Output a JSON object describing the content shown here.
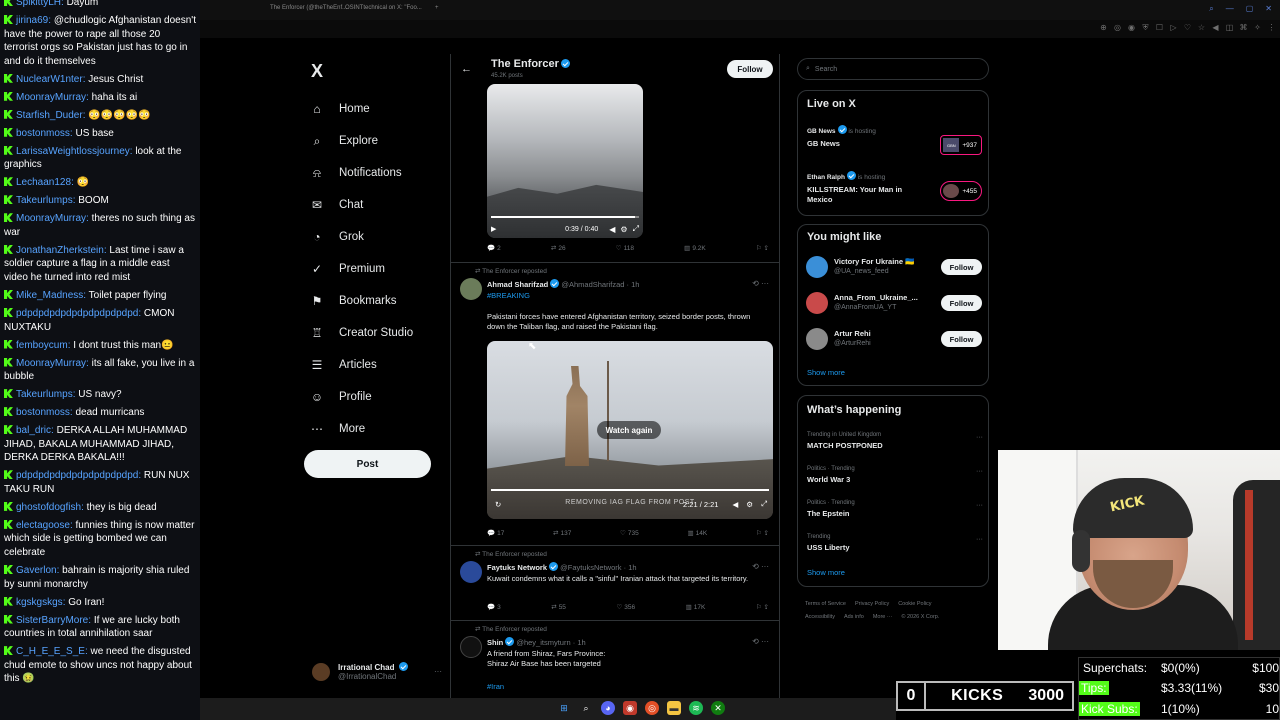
{
  "chat": {
    "messages": [
      {
        "user": "SpikittyLH",
        "text": "Dayum"
      },
      {
        "user": "jirina69",
        "text": "@chudlogic Afghanistan doesn't have the power to rape all those 20 terrorist orgs so Pakistan just has to go in and do it themselves"
      },
      {
        "user": "NuclearW1nter",
        "text": "Jesus Christ"
      },
      {
        "user": "MoonrayMurray",
        "text": "haha its ai"
      },
      {
        "user": "Starfish_Duder",
        "text": "😳😳😳😳😳"
      },
      {
        "user": "bostonmoss",
        "text": "US base"
      },
      {
        "user": "LarissaWeightlossjourney",
        "text": "look at the graphics"
      },
      {
        "user": "Lechaan128",
        "text": "😳"
      },
      {
        "user": "Takeurlumps",
        "text": "BOOM"
      },
      {
        "user": "MoonrayMurray",
        "text": "theres no such thing as war"
      },
      {
        "user": "JonathanZherkstein",
        "text": "Last time i saw a soldier capture a flag in a middle east video he turned into red mist"
      },
      {
        "user": "Mike_Madness",
        "text": "Toilet paper flying"
      },
      {
        "user": "pdpdpdpdpdpdpdpdpdpdpd",
        "text": "CMON NUXTAKU"
      },
      {
        "user": "femboycum",
        "text": "I dont trust this man😐"
      },
      {
        "user": "MoonrayMurray",
        "text": "its all fake, you live in a bubble"
      },
      {
        "user": "Takeurlumps",
        "text": "US navy?"
      },
      {
        "user": "bostonmoss",
        "text": "dead murricans"
      },
      {
        "user": "bal_dric",
        "text": "DERKA ALLAH MUHAMMAD JIHAD, BAKALA MUHAMMAD JIHAD, DERKA DERKA BAKALA!!!"
      },
      {
        "user": "pdpdpdpdpdpdpdpdpdpdpd",
        "text": "RUN NUX TAKU RUN"
      },
      {
        "user": "ghostofdogfish",
        "text": "they is big dead"
      },
      {
        "user": "electagoose",
        "text": "funnies thing is now matter which side is getting bombed we can celebrate"
      },
      {
        "user": "Gaverlon",
        "text": "bahrain is majority shia ruled by sunni monarchy"
      },
      {
        "user": "kgskgskgs",
        "text": "Go Iran!"
      },
      {
        "user": "SisterBarryMore",
        "text": "If we are lucky both countries in total annihilation saar"
      },
      {
        "user": "C_H_E_E_S_E",
        "text": "we need the disgusted chud emote to show uncs not happy about this 🤢"
      }
    ]
  },
  "browser": {
    "tabs": [
      "The Enforcer (@theTheEnf...",
      "OSINTtechnical on X: \"Foo...",
      "+"
    ]
  },
  "nav": {
    "logo": "X",
    "items": [
      {
        "key": "home",
        "label": "Home",
        "icon": "⌂"
      },
      {
        "key": "explore",
        "label": "Explore",
        "icon": "⌕"
      },
      {
        "key": "notifications",
        "label": "Notifications",
        "icon": "⍾"
      },
      {
        "key": "chat",
        "label": "Chat",
        "icon": "✉"
      },
      {
        "key": "grok",
        "label": "Grok",
        "icon": "◔"
      },
      {
        "key": "premium",
        "label": "Premium",
        "icon": "✓"
      },
      {
        "key": "bookmarks",
        "label": "Bookmarks",
        "icon": "⚑"
      },
      {
        "key": "creator-studio",
        "label": "Creator Studio",
        "icon": "♖"
      },
      {
        "key": "articles",
        "label": "Articles",
        "icon": "☰"
      },
      {
        "key": "profile",
        "label": "Profile",
        "icon": "☺"
      },
      {
        "key": "more",
        "label": "More",
        "icon": "⋯"
      }
    ],
    "post_label": "Post",
    "account": {
      "name": "Irrational Chad",
      "handle": "@IrrationalChad",
      "more": "···"
    }
  },
  "feed": {
    "back": "←",
    "profile_name": "The Enforcer",
    "profile_posts": "45.2K posts",
    "follow_label": "Follow",
    "video1": {
      "time": "0:39 / 0:40",
      "progress": 0.975
    },
    "actions1": {
      "replies": "2",
      "reposts": "26",
      "likes": "118",
      "views": "9.2K"
    },
    "tweet1": {
      "repost": "The Enforcer reposted",
      "name": "Ahmad Sharifzad",
      "handle": "@AhmadSharifzad",
      "time": "1h",
      "tag": "#BREAKING",
      "body": "Pakistani forces have entered Afghanistan territory, seized border posts, thrown down the Taliban flag, and raised the Pakistani flag.",
      "video_caption": "REMOVING IAG FLAG FROM POST",
      "watch_again": "Watch again",
      "video_time": "2:21 / 2:21",
      "actions": {
        "replies": "17",
        "reposts": "137",
        "likes": "735",
        "views": "14K"
      }
    },
    "tweet2": {
      "repost": "The Enforcer reposted",
      "name": "Faytuks Network",
      "handle": "@FaytuksNetwork",
      "time": "1h",
      "body": "Kuwait condemns what it calls a \"sinful\" Iranian attack that targeted its territory.",
      "actions": {
        "replies": "3",
        "reposts": "55",
        "likes": "356",
        "views": "17K"
      }
    },
    "tweet3": {
      "repost": "The Enforcer reposted",
      "name": "Shin",
      "handle": "@hey_itsmyturn",
      "time": "1h",
      "body": "A friend from Shiraz, Fars Province:\nShiraz Air Base has been targeted",
      "tag": "#Iran"
    }
  },
  "sidebar": {
    "search_placeholder": "Search",
    "live": {
      "title": "Live on X",
      "items": [
        {
          "host": "GB News",
          "hosting": "is hosting",
          "title": "GB News",
          "count": "+937",
          "thumb": "GBN"
        },
        {
          "host": "Ethan Ralph",
          "hosting": "is hosting",
          "title": "KILLSTREAM: Your Man in Mexico",
          "count": "+455",
          "thumb": ""
        }
      ]
    },
    "wtf": {
      "title": "You might like",
      "items": [
        {
          "name": "Victory For Ukraine 🇺🇦",
          "handle": "@UA_news_feed",
          "follow": "Follow",
          "color": "#3a8fd8"
        },
        {
          "name": "Anna_From_Ukraine_...",
          "handle": "@AnnaFromUA_YT",
          "follow": "Follow",
          "color": "#c94a4a"
        },
        {
          "name": "Artur Rehi",
          "handle": "@ArturRehi",
          "follow": "Follow",
          "color": "#8a8a8a"
        }
      ],
      "show_more": "Show more"
    },
    "happening": {
      "title": "What’s happening",
      "items": [
        {
          "ctx": "Trending in United Kingdom",
          "name": "MATCH POSTPONED"
        },
        {
          "ctx": "Politics · Trending",
          "name": "World War 3"
        },
        {
          "ctx": "Politics · Trending",
          "name": "The Epstein"
        },
        {
          "ctx": "Trending",
          "name": "USS Liberty"
        }
      ],
      "show_more": "Show more",
      "dots": "···"
    },
    "footer": [
      "Terms of Service",
      "Privacy Policy",
      "Cookie Policy",
      "Accessibility",
      "Ads info",
      "More ···",
      "© 2026 X Corp."
    ]
  },
  "webcam": {
    "cap_text": "KICK"
  },
  "stats": {
    "superchats": {
      "label": "Superchats:",
      "value": "$0(0%)",
      "goal": "$100"
    },
    "tips": {
      "label": "Tips:",
      "value": "$3.33(11%)",
      "goal": "$30"
    },
    "kicksubs": {
      "label": "Kick Subs:",
      "value": "1(10%)",
      "goal": "10"
    }
  },
  "kicks": {
    "current": "0",
    "label": "KICKS",
    "goal": "3000"
  },
  "colors": {
    "accent": "#1d9bf0",
    "kick_green": "#53fc18",
    "live_pink": "#f91880"
  }
}
